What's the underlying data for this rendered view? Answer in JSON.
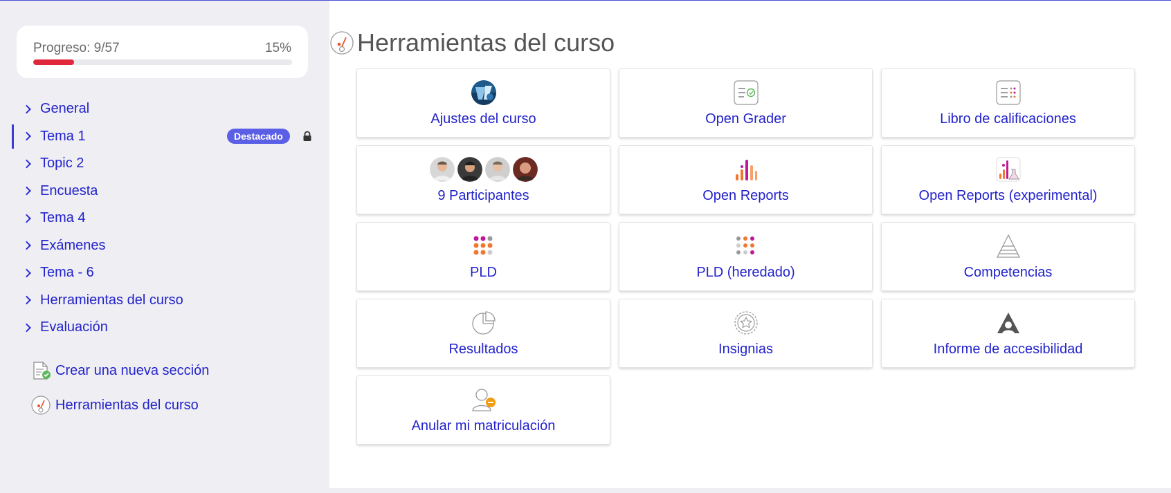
{
  "progress": {
    "label": "Progreso: 9/57",
    "percent_text": "15%",
    "fraction": 0.158
  },
  "sidebar": {
    "items": [
      {
        "label": "General",
        "active": false
      },
      {
        "label": "Tema 1",
        "active": true,
        "badge": "Destacado",
        "locked": true
      },
      {
        "label": "Topic 2",
        "active": false
      },
      {
        "label": "Encuesta",
        "active": false
      },
      {
        "label": "Tema 4",
        "active": false
      },
      {
        "label": "Exámenes",
        "active": false
      },
      {
        "label": "Tema - 6",
        "active": false
      },
      {
        "label": "Herramientas del curso",
        "active": false
      },
      {
        "label": "Evaluación",
        "active": false
      }
    ],
    "create_section": "Crear una nueva sección",
    "course_tools": "Herramientas del curso"
  },
  "main": {
    "title": "Herramientas del curso",
    "tiles": [
      {
        "label": "Ajustes del curso",
        "icon": "course-settings-icon"
      },
      {
        "label": "Open Grader",
        "icon": "grader-icon"
      },
      {
        "label": "Libro de calificaciones",
        "icon": "gradebook-icon"
      },
      {
        "label": "9 Participantes",
        "icon": "participants-avatars"
      },
      {
        "label": "Open Reports",
        "icon": "reports-icon"
      },
      {
        "label": "Open Reports (experimental)",
        "icon": "reports-experimental-icon"
      },
      {
        "label": "PLD",
        "icon": "pld-icon"
      },
      {
        "label": "PLD (heredado)",
        "icon": "pld-legacy-icon"
      },
      {
        "label": "Competencias",
        "icon": "competencies-icon"
      },
      {
        "label": "Resultados",
        "icon": "outcomes-icon"
      },
      {
        "label": "Insignias",
        "icon": "badges-icon"
      },
      {
        "label": "Informe de accesibilidad",
        "icon": "accessibility-icon"
      },
      {
        "label": "Anular mi matriculación",
        "icon": "unenrol-icon"
      }
    ]
  },
  "colors": {
    "link": "#2323cc",
    "progress_fill": "#e0283c",
    "badge": "#5b5fe6",
    "sidebar_bg": "#eeeef3"
  }
}
